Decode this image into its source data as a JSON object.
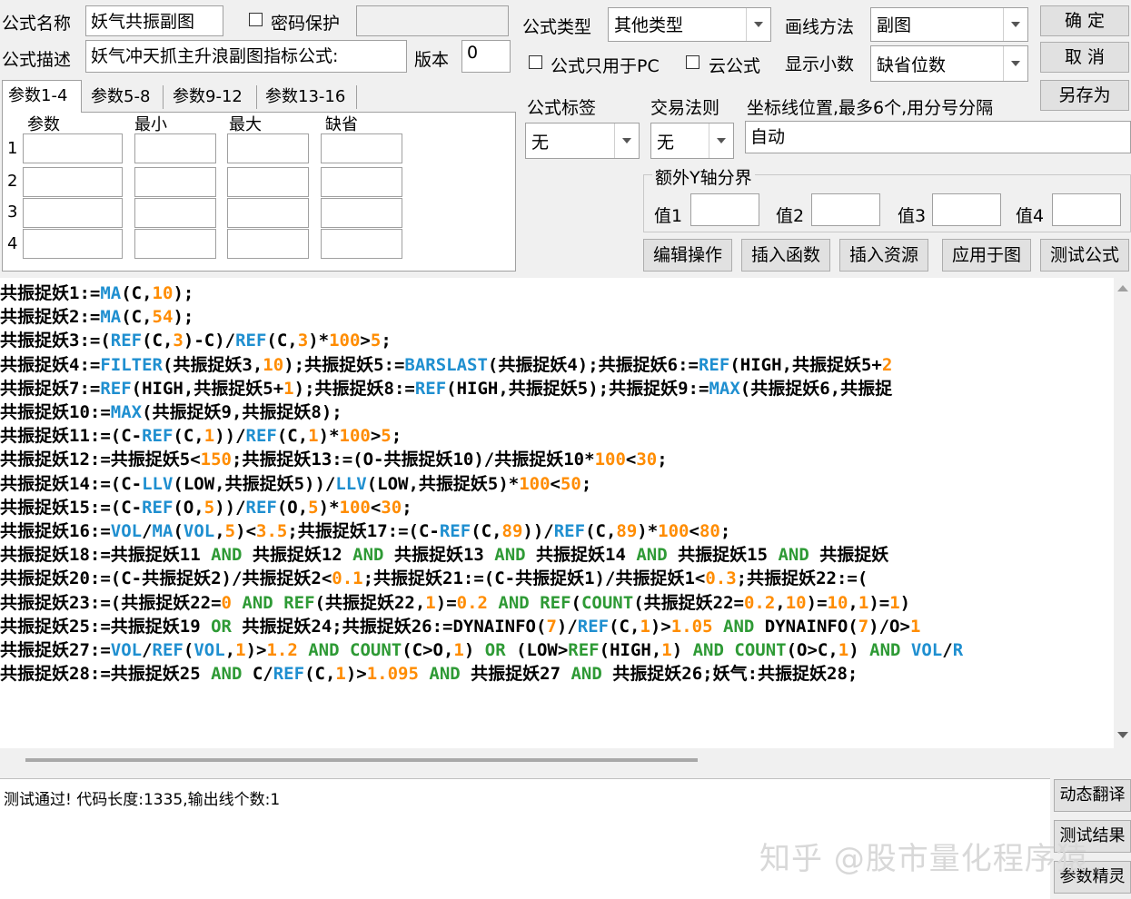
{
  "header": {
    "name_label": "公式名称",
    "name_value": "妖气共振副图",
    "password_label": "密码保护",
    "desc_label": "公式描述",
    "desc_value": "妖气冲天抓主升浪副图指标公式:",
    "version_label": "版本",
    "version_value": "0",
    "type_label": "公式类型",
    "type_value": "其他类型",
    "draw_label": "画线方法",
    "draw_value": "副图",
    "pc_only_label": "公式只用于PC",
    "cloud_label": "云公式",
    "decimal_label": "显示小数",
    "decimal_value": "缺省位数"
  },
  "buttons": {
    "ok": "确  定",
    "cancel": "取  消",
    "save_as": "另存为",
    "edit_ops": "编辑操作",
    "insert_func": "插入函数",
    "insert_res": "插入资源",
    "apply_chart": "应用于图",
    "test_formula": "测试公式",
    "dyn_translate": "动态翻译",
    "test_result": "测试结果",
    "param_wizard": "参数精灵"
  },
  "tabs": [
    "参数1-4",
    "参数5-8",
    "参数9-12",
    "参数13-16"
  ],
  "params": {
    "headers": [
      "参数",
      "最小",
      "最大",
      "缺省"
    ],
    "rows": [
      "1",
      "2",
      "3",
      "4"
    ]
  },
  "options": {
    "tag_label": "公式标签",
    "tag_value": "无",
    "rule_label": "交易法则",
    "rule_value": "无",
    "coord_label": "坐标线位置,最多6个,用分号分隔",
    "coord_value": "自动",
    "yaxis_label": "额外Y轴分界",
    "v1": "值1",
    "v2": "值2",
    "v3": "值3",
    "v4": "值4"
  },
  "code_lines": [
    [
      [
        "共振捉妖1:=",
        ""
      ],
      [
        "MA",
        "f"
      ],
      [
        "(C,",
        ""
      ],
      [
        "10",
        "n"
      ],
      [
        ");",
        ""
      ]
    ],
    [
      [
        "共振捉妖2:=",
        ""
      ],
      [
        "MA",
        "f"
      ],
      [
        "(C,",
        ""
      ],
      [
        "54",
        "n"
      ],
      [
        ");",
        ""
      ]
    ],
    [
      [
        "共振捉妖3:=(",
        ""
      ],
      [
        "REF",
        "f"
      ],
      [
        "(C,",
        ""
      ],
      [
        "3",
        "n"
      ],
      [
        ")-C)/",
        ""
      ],
      [
        "REF",
        "f"
      ],
      [
        "(C,",
        ""
      ],
      [
        "3",
        "n"
      ],
      [
        ")*",
        ""
      ],
      [
        "100",
        "n"
      ],
      [
        ">",
        ""
      ],
      [
        "5",
        "n"
      ],
      [
        ";",
        ""
      ]
    ],
    [
      [
        "共振捉妖4:=",
        ""
      ],
      [
        "FILTER",
        "f"
      ],
      [
        "(共振捉妖3,",
        ""
      ],
      [
        "10",
        "n"
      ],
      [
        ");共振捉妖5:=",
        ""
      ],
      [
        "BARSLAST",
        "f"
      ],
      [
        "(共振捉妖4);共振捉妖6:=",
        ""
      ],
      [
        "REF",
        "f"
      ],
      [
        "(HIGH,共振捉妖5+",
        ""
      ],
      [
        "2",
        "n"
      ]
    ],
    [
      [
        "共振捉妖7:=",
        ""
      ],
      [
        "REF",
        "f"
      ],
      [
        "(HIGH,共振捉妖5+",
        ""
      ],
      [
        "1",
        "n"
      ],
      [
        ");共振捉妖8:=",
        ""
      ],
      [
        "REF",
        "f"
      ],
      [
        "(HIGH,共振捉妖5);共振捉妖9:=",
        ""
      ],
      [
        "MAX",
        "f"
      ],
      [
        "(共振捉妖6,共振捉",
        ""
      ]
    ],
    [
      [
        "共振捉妖10:=",
        ""
      ],
      [
        "MAX",
        "f"
      ],
      [
        "(共振捉妖9,共振捉妖8);",
        ""
      ]
    ],
    [
      [
        "共振捉妖11:=(C-",
        ""
      ],
      [
        "REF",
        "f"
      ],
      [
        "(C,",
        ""
      ],
      [
        "1",
        "n"
      ],
      [
        "))/",
        ""
      ],
      [
        "REF",
        "f"
      ],
      [
        "(C,",
        ""
      ],
      [
        "1",
        "n"
      ],
      [
        ")*",
        ""
      ],
      [
        "100",
        "n"
      ],
      [
        ">",
        ""
      ],
      [
        "5",
        "n"
      ],
      [
        ";",
        ""
      ]
    ],
    [
      [
        "共振捉妖12:=共振捉妖5<",
        ""
      ],
      [
        "150",
        "n"
      ],
      [
        ";共振捉妖13:=(O-共振捉妖10)/共振捉妖10*",
        ""
      ],
      [
        "100",
        "n"
      ],
      [
        "<",
        ""
      ],
      [
        "30",
        "n"
      ],
      [
        ";",
        ""
      ]
    ],
    [
      [
        "共振捉妖14:=(C-",
        ""
      ],
      [
        "LLV",
        "f"
      ],
      [
        "(LOW,共振捉妖5))/",
        ""
      ],
      [
        "LLV",
        "f"
      ],
      [
        "(LOW,共振捉妖5)*",
        ""
      ],
      [
        "100",
        "n"
      ],
      [
        "<",
        ""
      ],
      [
        "50",
        "n"
      ],
      [
        ";",
        ""
      ]
    ],
    [
      [
        "共振捉妖15:=(C-",
        ""
      ],
      [
        "REF",
        "f"
      ],
      [
        "(O,",
        ""
      ],
      [
        "5",
        "n"
      ],
      [
        "))/",
        ""
      ],
      [
        "REF",
        "f"
      ],
      [
        "(O,",
        ""
      ],
      [
        "5",
        "n"
      ],
      [
        ")*",
        ""
      ],
      [
        "100",
        "n"
      ],
      [
        "<",
        ""
      ],
      [
        "30",
        "n"
      ],
      [
        ";",
        ""
      ]
    ],
    [
      [
        "共振捉妖16:=",
        ""
      ],
      [
        "VOL",
        "f"
      ],
      [
        "/",
        ""
      ],
      [
        "MA",
        "f"
      ],
      [
        "(",
        ""
      ],
      [
        "VOL",
        "f"
      ],
      [
        ",",
        ""
      ],
      [
        "5",
        "n"
      ],
      [
        ")<",
        ""
      ],
      [
        "3.5",
        "n"
      ],
      [
        ";共振捉妖17:=(C-",
        ""
      ],
      [
        "REF",
        "f"
      ],
      [
        "(C,",
        ""
      ],
      [
        "89",
        "n"
      ],
      [
        "))/",
        ""
      ],
      [
        "REF",
        "f"
      ],
      [
        "(C,",
        ""
      ],
      [
        "89",
        "n"
      ],
      [
        ")*",
        ""
      ],
      [
        "100",
        "n"
      ],
      [
        "<",
        ""
      ],
      [
        "80",
        "n"
      ],
      [
        ";",
        ""
      ]
    ],
    [
      [
        "共振捉妖18:=共振捉妖11 ",
        ""
      ],
      [
        "AND",
        "k"
      ],
      [
        " 共振捉妖12 ",
        ""
      ],
      [
        "AND",
        "k"
      ],
      [
        " 共振捉妖13 ",
        ""
      ],
      [
        "AND",
        "k"
      ],
      [
        " 共振捉妖14 ",
        ""
      ],
      [
        "AND",
        "k"
      ],
      [
        " 共振捉妖15 ",
        ""
      ],
      [
        "AND",
        "k"
      ],
      [
        " 共振捉妖",
        ""
      ]
    ],
    [
      [
        "共振捉妖20:=(C-共振捉妖2)/共振捉妖2<",
        ""
      ],
      [
        "0.1",
        "n"
      ],
      [
        ";共振捉妖21:=(C-共振捉妖1)/共振捉妖1<",
        ""
      ],
      [
        "0.3",
        "n"
      ],
      [
        ";共振捉妖22:=(",
        ""
      ]
    ],
    [
      [
        "共振捉妖23:=(共振捉妖22=",
        ""
      ],
      [
        "0",
        "n"
      ],
      [
        " ",
        ""
      ],
      [
        "AND",
        "k"
      ],
      [
        " ",
        ""
      ],
      [
        "REF",
        "k"
      ],
      [
        "(共振捉妖22,",
        ""
      ],
      [
        "1",
        "n"
      ],
      [
        ")=",
        ""
      ],
      [
        "0.2",
        "n"
      ],
      [
        " ",
        ""
      ],
      [
        "AND",
        "k"
      ],
      [
        " ",
        ""
      ],
      [
        "REF",
        "k"
      ],
      [
        "(",
        ""
      ],
      [
        "COUNT",
        "k"
      ],
      [
        "(共振捉妖22=",
        ""
      ],
      [
        "0.2",
        "n"
      ],
      [
        ",",
        ""
      ],
      [
        "10",
        "n"
      ],
      [
        ")=",
        ""
      ],
      [
        "10",
        "n"
      ],
      [
        ",",
        ""
      ],
      [
        "1",
        "n"
      ],
      [
        ")=",
        ""
      ],
      [
        "1",
        "n"
      ],
      [
        ")",
        ""
      ]
    ],
    [
      [
        "共振捉妖25:=共振捉妖19 ",
        ""
      ],
      [
        "OR",
        "k"
      ],
      [
        " 共振捉妖24;共振捉妖26:=DYNAINFO(",
        ""
      ],
      [
        "7",
        "n"
      ],
      [
        ")/",
        ""
      ],
      [
        "REF",
        "f"
      ],
      [
        "(C,",
        ""
      ],
      [
        "1",
        "n"
      ],
      [
        ")>",
        ""
      ],
      [
        "1.05",
        "n"
      ],
      [
        " ",
        ""
      ],
      [
        "AND",
        "k"
      ],
      [
        " DYNAINFO(",
        ""
      ],
      [
        "7",
        "n"
      ],
      [
        ")/O>",
        ""
      ],
      [
        "1",
        "n"
      ]
    ],
    [
      [
        "共振捉妖27:=",
        ""
      ],
      [
        "VOL",
        "f"
      ],
      [
        "/",
        ""
      ],
      [
        "REF",
        "f"
      ],
      [
        "(",
        ""
      ],
      [
        "VOL",
        "f"
      ],
      [
        ",",
        ""
      ],
      [
        "1",
        "n"
      ],
      [
        ")>",
        ""
      ],
      [
        "1.2",
        "n"
      ],
      [
        " ",
        ""
      ],
      [
        "AND",
        "k"
      ],
      [
        " ",
        ""
      ],
      [
        "COUNT",
        "k"
      ],
      [
        "(C>O,",
        ""
      ],
      [
        "1",
        "n"
      ],
      [
        ") ",
        ""
      ],
      [
        "OR",
        "k"
      ],
      [
        " (LOW>",
        ""
      ],
      [
        "REF",
        "k"
      ],
      [
        "(HIGH,",
        ""
      ],
      [
        "1",
        "n"
      ],
      [
        ") ",
        ""
      ],
      [
        "AND",
        "k"
      ],
      [
        " ",
        ""
      ],
      [
        "COUNT",
        "k"
      ],
      [
        "(O>C,",
        ""
      ],
      [
        "1",
        "n"
      ],
      [
        ") ",
        ""
      ],
      [
        "AND",
        "k"
      ],
      [
        " ",
        ""
      ],
      [
        "VOL",
        "f"
      ],
      [
        "/",
        ""
      ],
      [
        "R",
        "f"
      ]
    ],
    [
      [
        "共振捉妖28:=共振捉妖25 ",
        ""
      ],
      [
        "AND",
        "k"
      ],
      [
        " C/",
        ""
      ],
      [
        "REF",
        "f"
      ],
      [
        "(C,",
        ""
      ],
      [
        "1",
        "n"
      ],
      [
        ")>",
        ""
      ],
      [
        "1.095",
        "n"
      ],
      [
        " ",
        ""
      ],
      [
        "AND",
        "k"
      ],
      [
        " 共振捉妖27 ",
        ""
      ],
      [
        "AND",
        "k"
      ],
      [
        " 共振捉妖26;妖气:共振捉妖28;",
        ""
      ]
    ]
  ],
  "status": {
    "message": "测试通过! 代码长度:1335,输出线个数:1"
  },
  "watermark": "知乎 @股市量化程序猿"
}
